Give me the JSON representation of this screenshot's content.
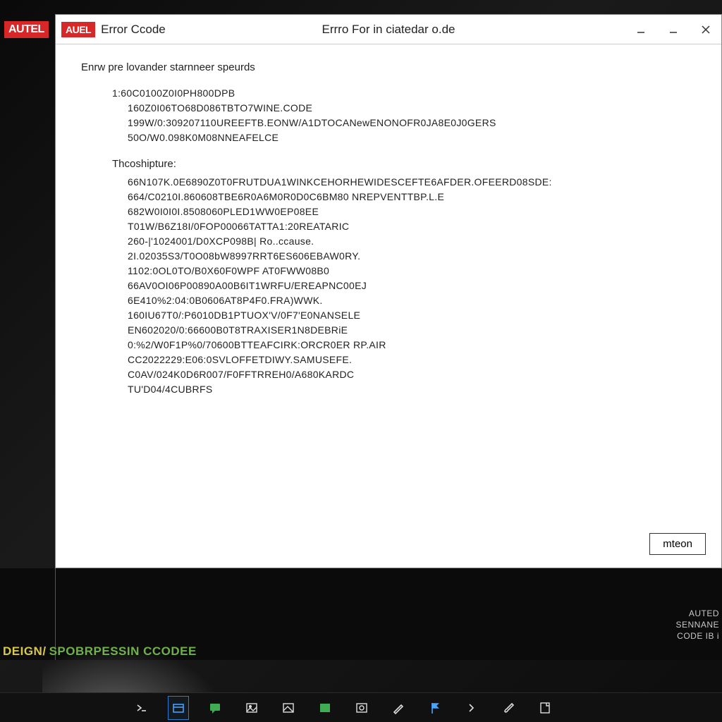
{
  "outer_logo": "AUTEL",
  "titlebar": {
    "app_logo": "AUEL",
    "title_left": "Error Ccode",
    "title_center": "Errro For in ciatedar o.de"
  },
  "window_buttons": {
    "min": "minimize",
    "max": "maximize",
    "close": "close"
  },
  "dialog": {
    "intro": "Enrw pre lovander starnneer speurds",
    "head_code": "1:60C0100Z0I0PH800DPB",
    "sub_codes": [
      "160Z0I06TO68D086TBTO7WINE.CODE",
      "199W/0:309207110UREEFTB.EONW/A1DTOCANewENONOFR0JA8E0J0GERS",
      "50O/W0.098K0M08NNEAFELCE"
    ],
    "section_label": "Thcoshipture:",
    "dump_lines": [
      "66N107K.0E6890Z0T0FRUTDUA1WINKCEHORHEWIDESCEFTE6AFDER.OFEERD08SDE:",
      "664/C0210I.860608TBE6R0A6M0R0D0C6BM80 NREPVENTTBP.L.E",
      "682W0I0I0I.8508060PLED1WW0EP08EE",
      "T01W/B6Z18I/0FOP00066TATTA1:20REATARIC",
      "260-|'1024001/D0XCP098B| Ro..ccause.",
      "2I.02035S3/T0O08bW8997RRT6ES606EBAW0RY.",
      "1102:0OL0TO/B0X60F0WPF AT0FWW08B0",
      "66AV0OI06P00890A00B6IT1WRFU/EREAPNC00EJ",
      "6E410%2:04:0B0606AT8P4F0.FRA)WWK.",
      "160IU67T0/:P6010DB1PTUOX'V/0F7'E0NANSELE",
      "EN602020/0:66600B0T8TRAXISER1N8DEBRiE",
      "0:%2/W0F1P%0/70600BTTEAFCIRK:ORCR0ER RP.AIR",
      "CC2022229:E06:0SVLOFFETDIWY.SAMUSEFE.",
      "C0AV/024K0D6R007/F0FFTRREH0/A680KARDC",
      "TU'D04/4CUBRFS"
    ],
    "button_label": "mteon"
  },
  "banner": {
    "left_seg1": "DEIGN/",
    "left_seg2": "SPOBRPESSIN CCODEE",
    "right_lines": [
      "AUTED",
      "SENNANE",
      "CODE IB i"
    ]
  }
}
